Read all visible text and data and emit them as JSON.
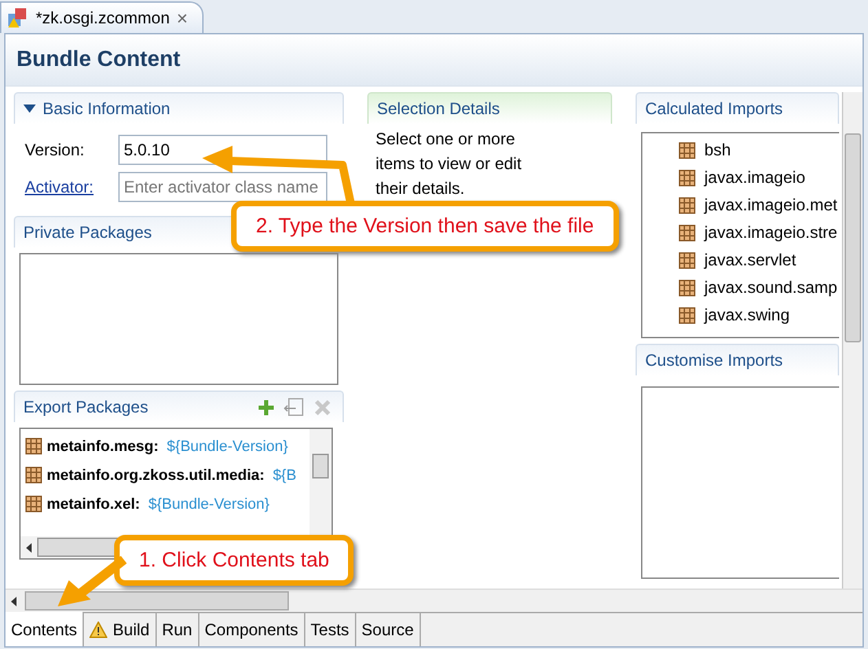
{
  "editor_tab": {
    "title": "*zk.osgi.zcommon",
    "close": "×"
  },
  "page_title": "Bundle Content",
  "basic_information": {
    "title": "Basic Information",
    "expanded": true,
    "version_label": "Version:",
    "version_value": "5.0.10",
    "activator_label": "Activator:",
    "activator_placeholder": "Enter activator class name"
  },
  "selection_details": {
    "title": "Selection Details",
    "text": "Select one or more items to view or edit their details."
  },
  "calculated_imports": {
    "title": "Calculated Imports",
    "items": [
      "bsh",
      "javax.imageio",
      "javax.imageio.met",
      "javax.imageio.stre",
      "javax.servlet",
      "javax.sound.samp",
      "javax.swing"
    ]
  },
  "private_packages": {
    "title": "Private Packages"
  },
  "export_packages": {
    "title": "Export Packages",
    "items": [
      {
        "name": "metainfo.mesg:",
        "version": "${Bundle-Version}"
      },
      {
        "name": "metainfo.org.zkoss.util.media:",
        "version": "${B"
      },
      {
        "name": "metainfo.xel:",
        "version": "${Bundle-Version}"
      }
    ]
  },
  "customise_imports": {
    "title": "Customise Imports"
  },
  "bottom_tabs": [
    {
      "label": "Contents",
      "selected": true,
      "warning": false
    },
    {
      "label": "Build",
      "selected": false,
      "warning": true
    },
    {
      "label": "Run",
      "selected": false,
      "warning": false
    },
    {
      "label": "Components",
      "selected": false,
      "warning": false
    },
    {
      "label": "Tests",
      "selected": false,
      "warning": false
    },
    {
      "label": "Source",
      "selected": false,
      "warning": false
    }
  ],
  "callouts": [
    {
      "text": "2. Type the Version then save the file"
    },
    {
      "text": "1. Click Contents tab"
    }
  ]
}
